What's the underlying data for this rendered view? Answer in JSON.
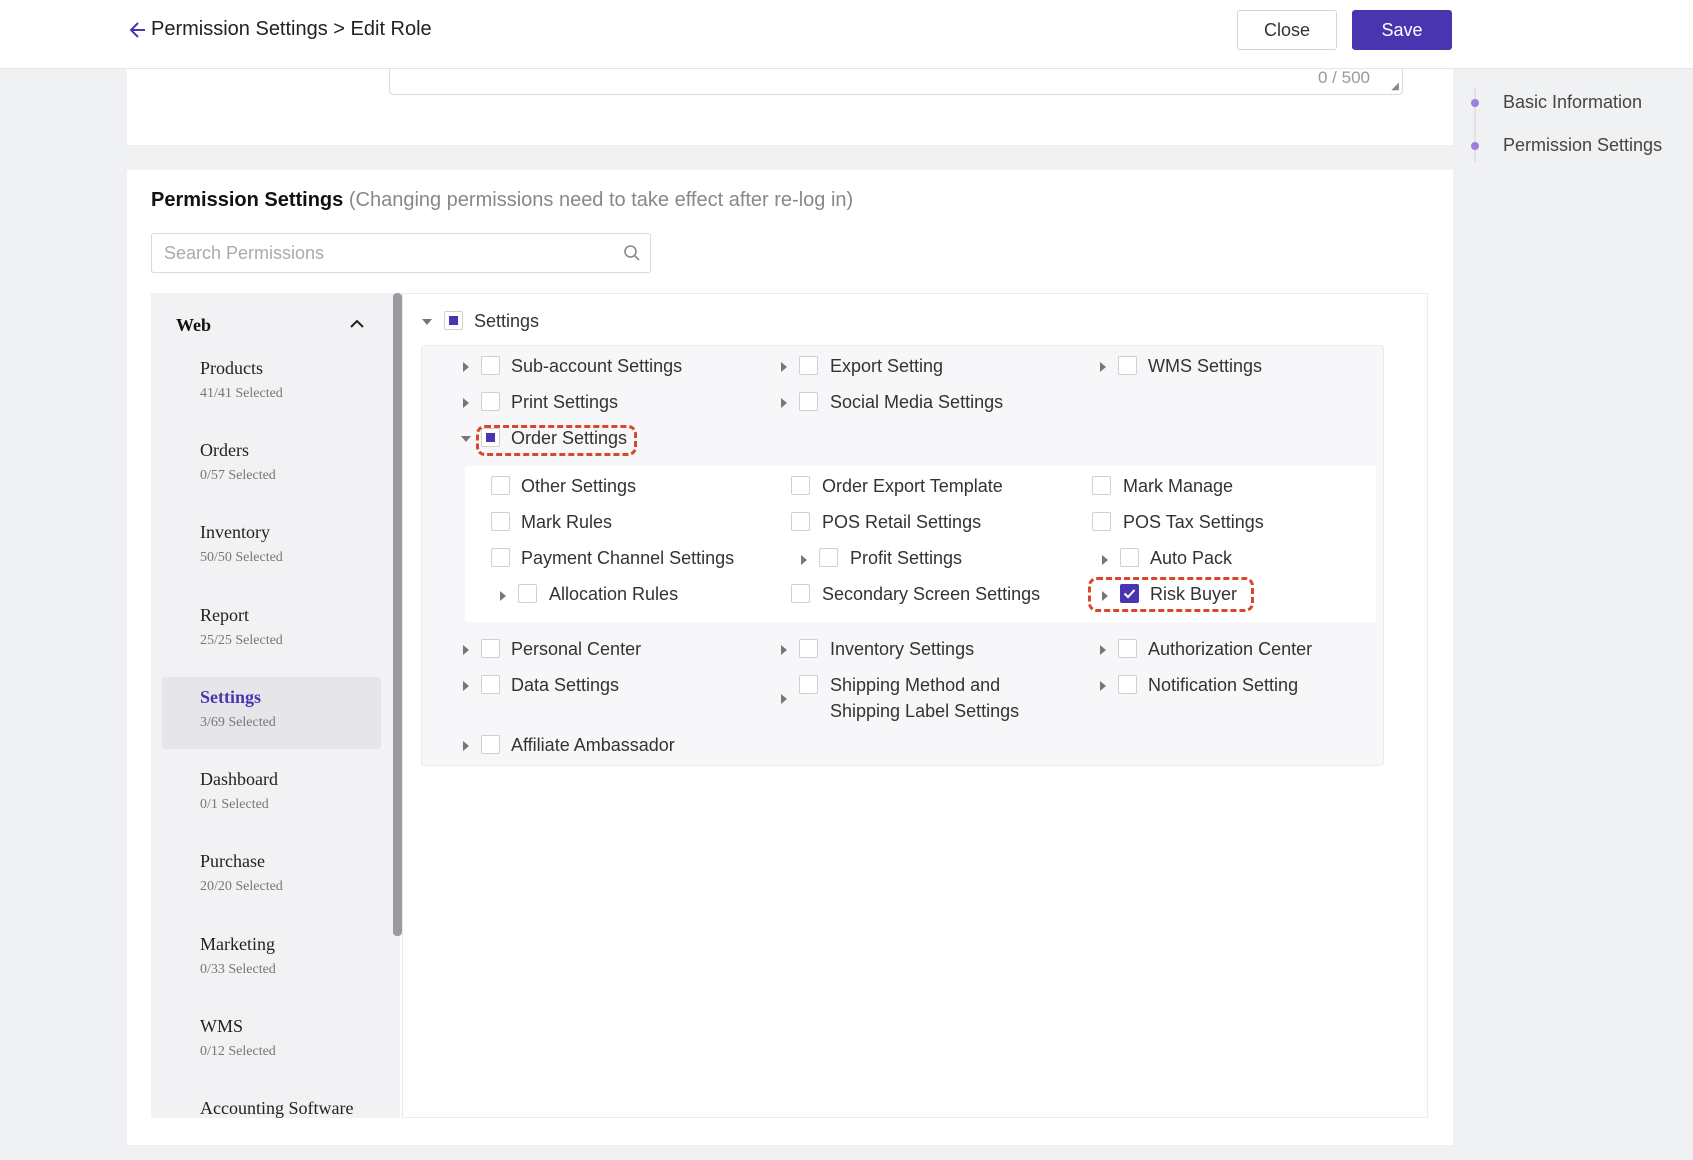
{
  "header": {
    "breadcrumb": "Permission Settings > Edit Role",
    "close_label": "Close",
    "save_label": "Save"
  },
  "anchor_nav": {
    "items": [
      {
        "label": "Basic Information"
      },
      {
        "label": "Permission Settings"
      }
    ]
  },
  "basic_info": {
    "description_counter": "0 / 500"
  },
  "permissions": {
    "title": "Permission Settings",
    "note": "(Changing permissions need to take effect after re-log in)",
    "search_placeholder": "Search Permissions",
    "nav": {
      "group_label": "Web",
      "items": [
        {
          "name": "Products",
          "count": "41/41 Selected"
        },
        {
          "name": "Orders",
          "count": "0/57 Selected"
        },
        {
          "name": "Inventory",
          "count": "50/50 Selected"
        },
        {
          "name": "Report",
          "count": "25/25 Selected"
        },
        {
          "name": "Settings",
          "count": "3/69 Selected",
          "active": true
        },
        {
          "name": "Dashboard",
          "count": "0/1 Selected"
        },
        {
          "name": "Purchase",
          "count": "20/20 Selected"
        },
        {
          "name": "Marketing",
          "count": "0/33 Selected"
        },
        {
          "name": "WMS",
          "count": "0/12 Selected"
        },
        {
          "name": "Accounting Software",
          "count": ""
        }
      ]
    },
    "tree": {
      "root": {
        "label": "Settings",
        "state": "partial"
      },
      "nodes": [
        {
          "label": "Sub-account Settings",
          "state": "unchecked"
        },
        {
          "label": "Export Setting",
          "state": "unchecked"
        },
        {
          "label": "WMS Settings",
          "state": "unchecked"
        },
        {
          "label": "Print Settings",
          "state": "unchecked"
        },
        {
          "label": "Social Media Settings",
          "state": "unchecked"
        },
        {
          "label": "Order Settings",
          "state": "partial",
          "expanded": true
        },
        {
          "label": "Personal Center",
          "state": "unchecked"
        },
        {
          "label": "Inventory Settings",
          "state": "unchecked"
        },
        {
          "label": "Authorization Center",
          "state": "unchecked"
        },
        {
          "label": "Data Settings",
          "state": "unchecked"
        },
        {
          "label": "Shipping Method and",
          "state": "unchecked"
        },
        {
          "label": "Notification Setting",
          "state": "unchecked"
        },
        {
          "label": "Affiliate Ambassador",
          "state": "unchecked"
        }
      ],
      "shipping_label_line2": "Shipping Label Settings",
      "order_children": [
        {
          "label": "Other Settings",
          "state": "unchecked"
        },
        {
          "label": "Order Export Template",
          "state": "unchecked"
        },
        {
          "label": "Mark Manage",
          "state": "unchecked"
        },
        {
          "label": "Mark Rules",
          "state": "unchecked"
        },
        {
          "label": "POS Retail Settings",
          "state": "unchecked"
        },
        {
          "label": "POS Tax Settings",
          "state": "unchecked"
        },
        {
          "label": "Payment Channel Settings",
          "state": "unchecked"
        },
        {
          "label": "Profit Settings",
          "state": "unchecked"
        },
        {
          "label": "Auto Pack",
          "state": "unchecked"
        },
        {
          "label": "Allocation Rules",
          "state": "unchecked"
        },
        {
          "label": "Secondary Screen Settings",
          "state": "unchecked"
        },
        {
          "label": "Risk Buyer",
          "state": "checked"
        }
      ]
    }
  },
  "colors": {
    "accent": "#4a35b0",
    "highlight": "#d9472b"
  }
}
